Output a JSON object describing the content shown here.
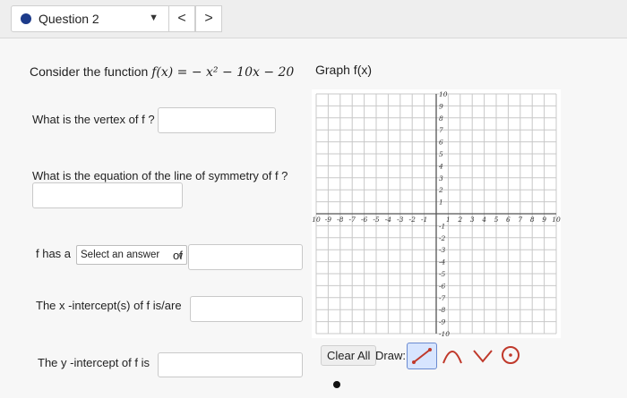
{
  "question": {
    "label": "Question 2",
    "nav_prev": "<",
    "nav_next": ">"
  },
  "prompt": {
    "intro": "Consider the function",
    "function_lhs": "f(x) = ",
    "function_rhs": "− x² − 10x − 20",
    "graph_label": "Graph f(x)"
  },
  "questions": {
    "vertex": "What is the vertex of f ?",
    "symmetry": "What is the equation of the line of symmetry of f ?",
    "has_a_prefix": "f  has a",
    "select_answer": "Select an answer",
    "of_label": "of",
    "x_intercepts": "The x -intercept(s) of f  is/are",
    "y_intercept": "The y -intercept of f  is"
  },
  "graph": {
    "x_range": [
      -10,
      10
    ],
    "y_range": [
      -10,
      10
    ],
    "x_ticks": [
      "10",
      "-9",
      "-8",
      "-7",
      "-6",
      "-5",
      "-4",
      "-3",
      "-2",
      "-1",
      "1",
      "2",
      "3",
      "4",
      "5",
      "6",
      "7",
      "8",
      "9",
      "10"
    ],
    "y_ticks": [
      "10",
      "9",
      "8",
      "7",
      "6",
      "5",
      "4",
      "3",
      "2",
      "1",
      "-1",
      "-2",
      "-3",
      "-4",
      "-5",
      "-6",
      "-7",
      "-8",
      "-9",
      "-10"
    ]
  },
  "tools": {
    "clear_all": "Clear All",
    "draw_label": "Draw:",
    "icons": [
      "line-icon",
      "parabola-icon",
      "absolute-value-icon",
      "circle-icon"
    ]
  }
}
